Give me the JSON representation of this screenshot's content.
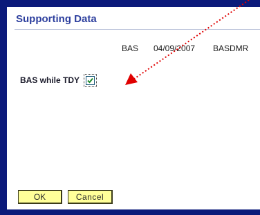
{
  "dialog": {
    "title": "Supporting Data"
  },
  "record": {
    "code": "BAS",
    "date": "04/09/2007",
    "source": "BASDMR"
  },
  "option": {
    "label": "BAS while TDY",
    "checked": true
  },
  "buttons": {
    "ok_label": "OK",
    "cancel_label": "Cancel"
  },
  "colors": {
    "frame": "#0b1a7a",
    "title": "#2d3f9e",
    "button_fill": "#ffff99",
    "annotation_arrow": "#e00000"
  },
  "icons": {
    "check": "checkmark-icon",
    "arrow": "red-dotted-arrow-icon"
  }
}
